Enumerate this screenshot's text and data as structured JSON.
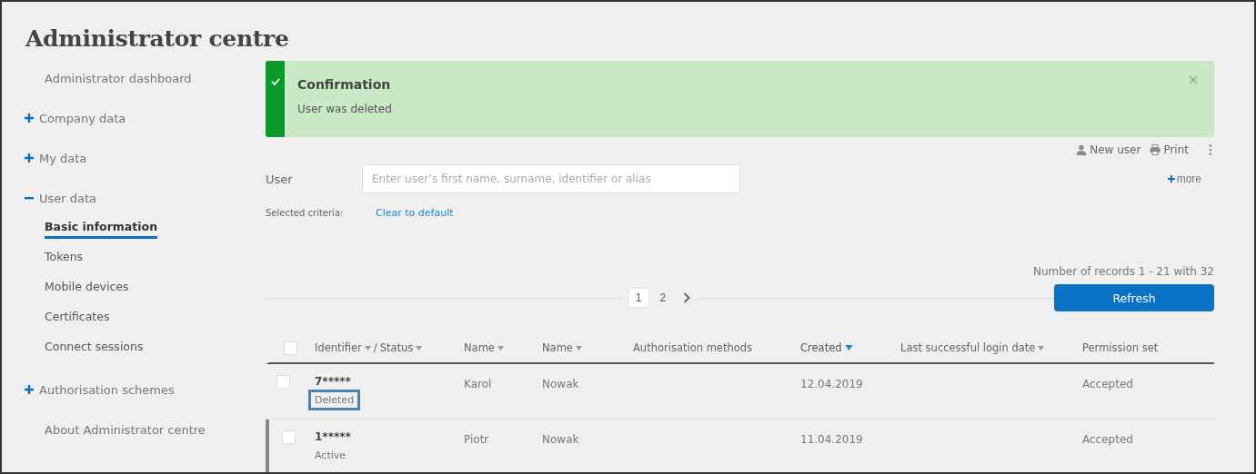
{
  "page": {
    "title": "Administrator centre"
  },
  "sidebar": {
    "items": [
      {
        "label": "Administrator dashboard",
        "kind": "link",
        "selected": false
      },
      {
        "label": "Company data",
        "kind": "group",
        "expanded": false
      },
      {
        "label": "My data",
        "kind": "group",
        "expanded": false
      },
      {
        "label": "User data",
        "kind": "group",
        "expanded": true,
        "children": [
          {
            "label": "Basic information",
            "kind": "link",
            "selected": true
          },
          {
            "label": "Tokens",
            "kind": "link",
            "selected": false
          },
          {
            "label": "Mobile devices",
            "kind": "link",
            "selected": false
          },
          {
            "label": "Certificates",
            "kind": "link",
            "selected": false
          },
          {
            "label": "Connect sessions",
            "kind": "link",
            "selected": false
          }
        ]
      },
      {
        "label": "Authorisation schemes",
        "kind": "group",
        "expanded": false
      },
      {
        "label": "About Administrator centre",
        "kind": "link",
        "selected": false
      }
    ]
  },
  "notification": {
    "title": "Confirmation",
    "message": "User was deleted"
  },
  "toolbar": {
    "actions": [
      {
        "label": "New user",
        "kind": "user"
      },
      {
        "label": "Print",
        "kind": "print"
      }
    ]
  },
  "filter": {
    "label": "User",
    "placeholder": "Enter user’s first name, surname, identifier or alias",
    "more": "more",
    "criteria_label": "Selected criteria:",
    "clear": "Clear to default"
  },
  "records": "Number of records 1 - 21 with 32",
  "pagination": {
    "pages": [
      {
        "label": "1",
        "selected": true
      },
      {
        "label": "2",
        "selected": false
      }
    ]
  },
  "refresh": "Refresh",
  "table": {
    "all_checked": false,
    "columns": [
      {
        "separator": "/",
        "parts": [
          {
            "label": "Identifier",
            "sortable": true,
            "sorted": false
          },
          {
            "label": "Status",
            "sortable": true,
            "sorted": false
          }
        ]
      },
      {
        "parts": [
          {
            "label": "Name",
            "sortable": true,
            "sorted": false
          }
        ]
      },
      {
        "parts": [
          {
            "label": "Name",
            "sortable": true,
            "sorted": false
          }
        ]
      },
      {
        "parts": [
          {
            "label": "Authorisation methods",
            "sortable": false
          }
        ]
      },
      {
        "parts": [
          {
            "label": "Created",
            "sortable": true,
            "sorted": true
          }
        ]
      },
      {
        "parts": [
          {
            "label": "Last successful login date",
            "sortable": true,
            "sorted": false
          }
        ]
      },
      {
        "parts": [
          {
            "label": "Permission set",
            "sortable": false
          }
        ]
      }
    ],
    "rows": [
      {
        "identifier": "7*****",
        "status": "Deleted",
        "highlighted": true,
        "hovered": false,
        "checked": false,
        "first_name": "Karol",
        "last_name": "Nowak",
        "created": "12.04.2019",
        "permission_set": "Accepted"
      },
      {
        "identifier": "1*****",
        "status": "Active",
        "highlighted": false,
        "hovered": true,
        "checked": false,
        "first_name": "Piotr",
        "last_name": "Nowak",
        "created": "11.04.2019",
        "permission_set": "Accepted"
      }
    ]
  }
}
